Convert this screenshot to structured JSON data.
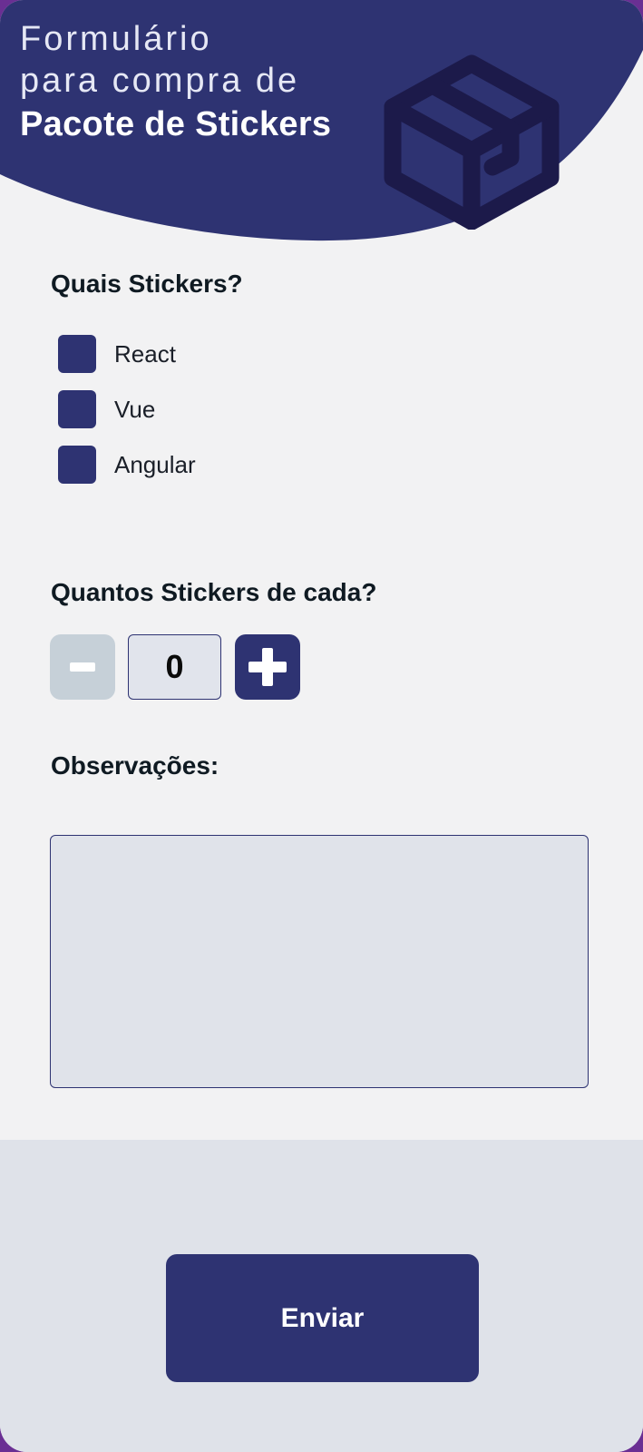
{
  "header": {
    "title_line1": "Formulário",
    "title_line2": "para compra de",
    "title_line3": "Pacote de Stickers",
    "icon": "package-box-icon"
  },
  "stickers": {
    "question": "Quais Stickers?",
    "options": [
      {
        "label": "React",
        "checked": false
      },
      {
        "label": "Vue",
        "checked": false
      },
      {
        "label": "Angular",
        "checked": false
      }
    ]
  },
  "quantity": {
    "question": "Quantos Stickers de cada?",
    "value": "0",
    "decrement_icon": "minus-icon",
    "increment_icon": "plus-icon"
  },
  "observations": {
    "label": "Observações:",
    "value": ""
  },
  "footer": {
    "submit_label": "Enviar"
  },
  "colors": {
    "primary": "#2e3372",
    "icon_dark": "#1c1a4a",
    "background": "#f2f2f3",
    "footer_background": "#dfe2e9",
    "disabled_button": "#c6d0d8",
    "frame": "#6a2f93"
  }
}
